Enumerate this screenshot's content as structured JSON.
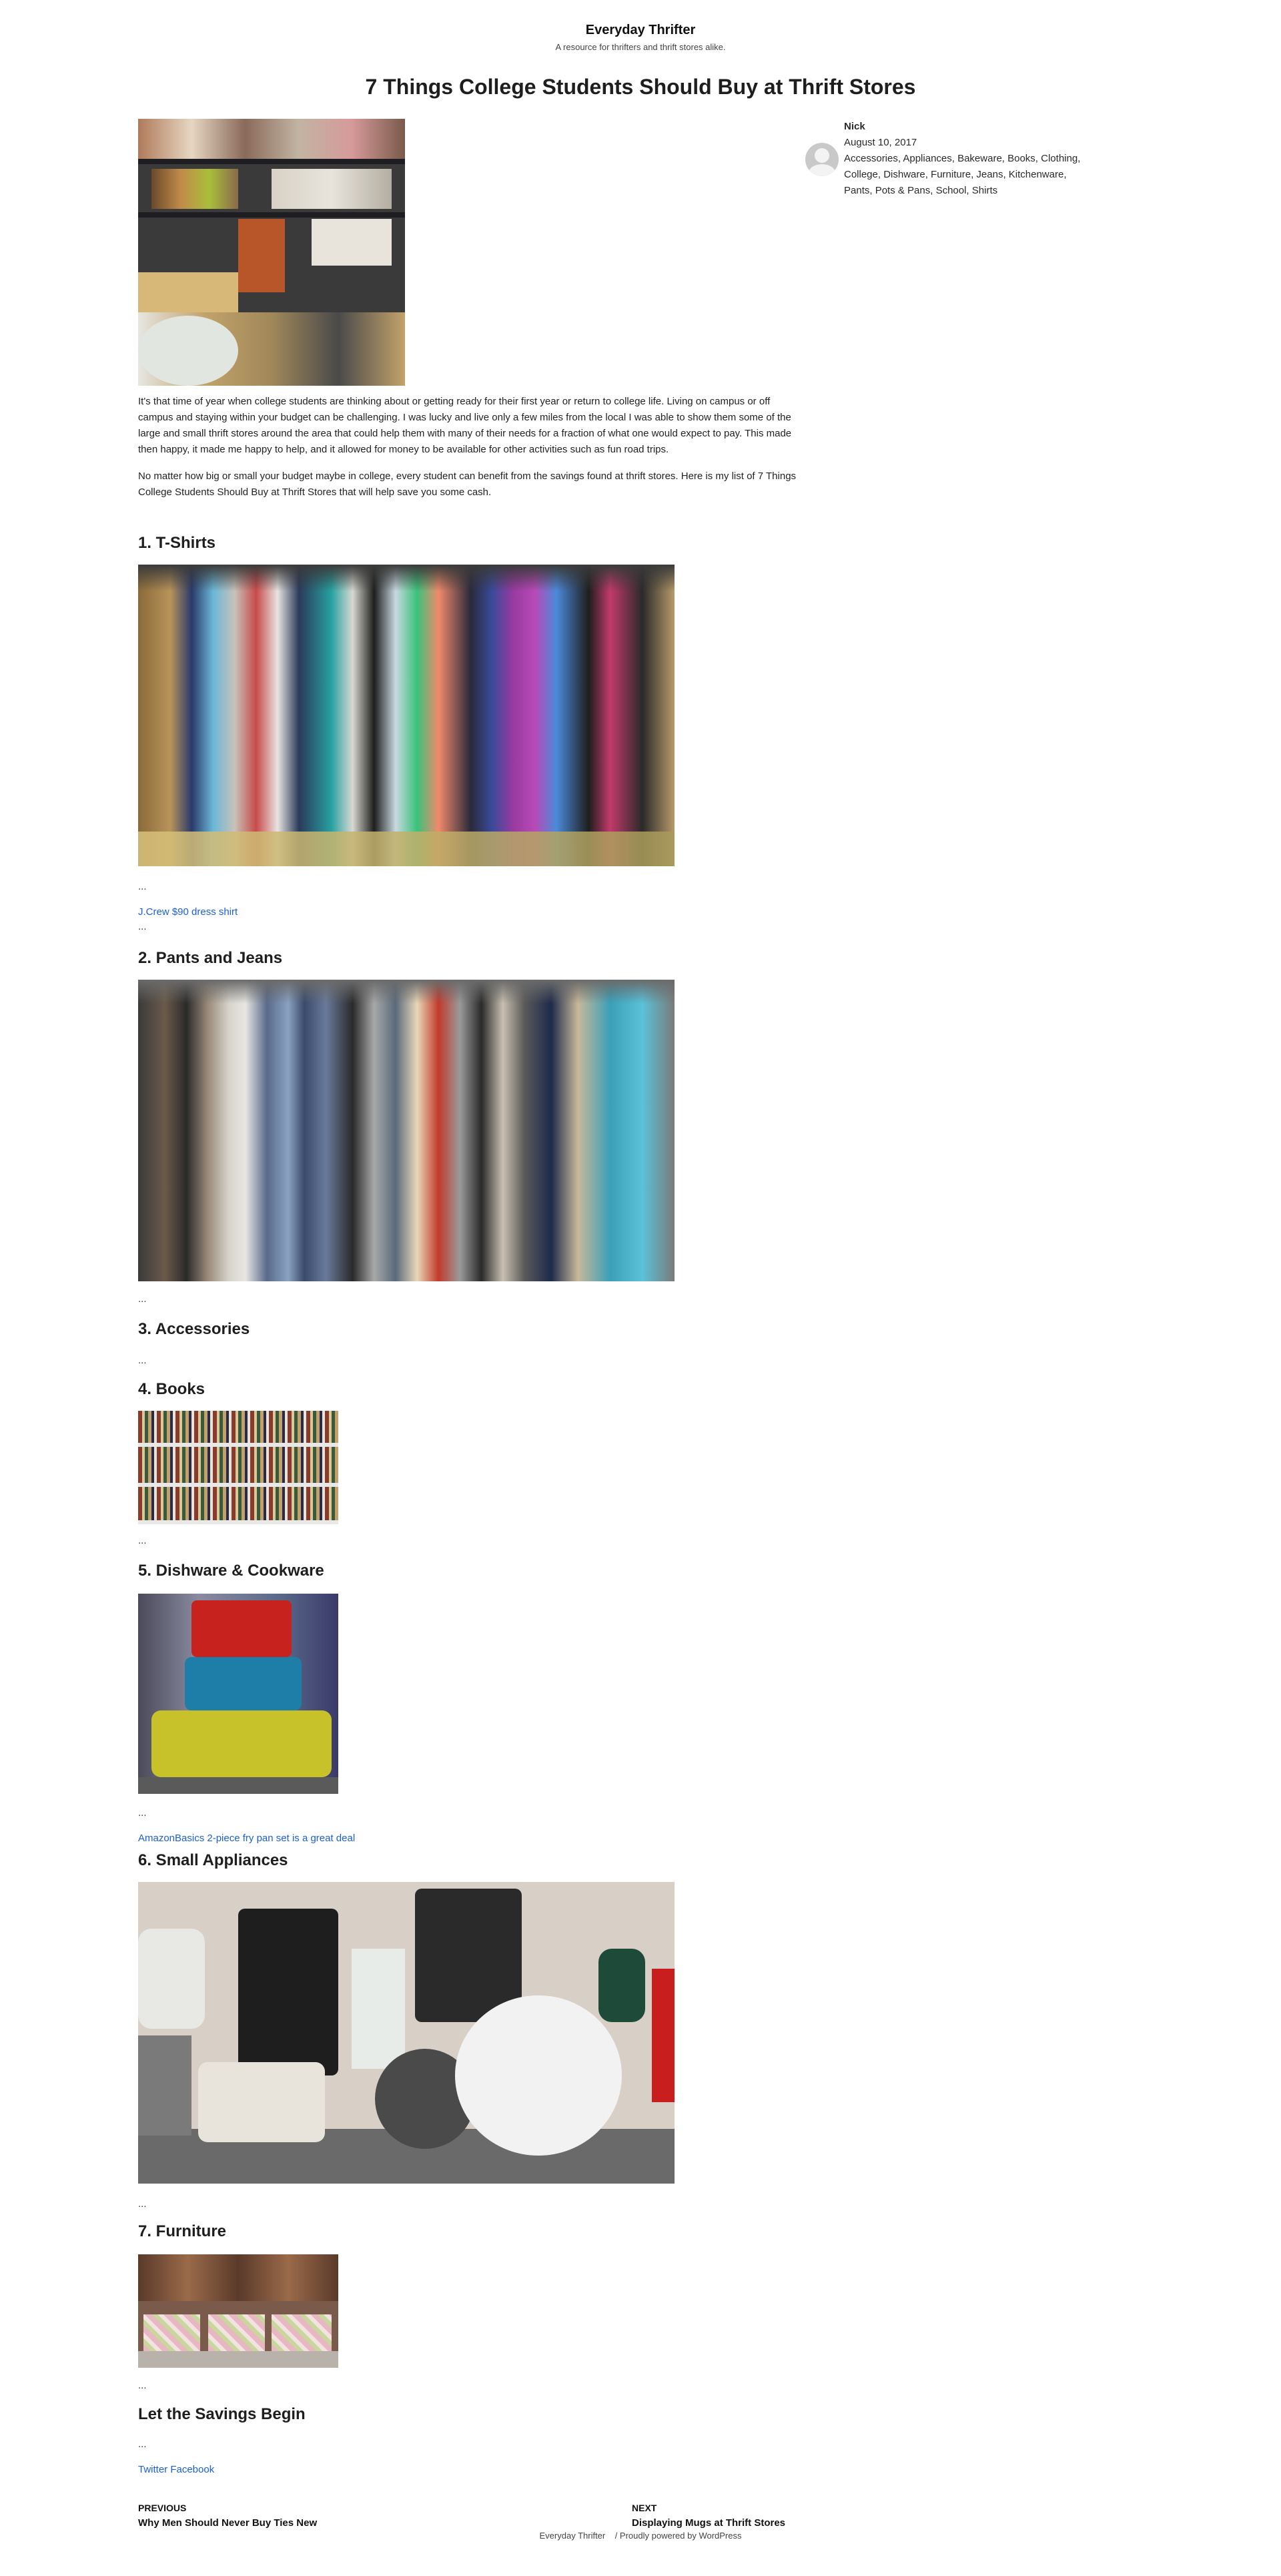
{
  "site": {
    "title": "Everyday Thrifter",
    "tagline": "A resource for thrifters and thrift stores alike."
  },
  "post": {
    "title": "7 Things College Students Should Buy at Thrift Stores",
    "intro_paragraphs": [
      "It's that time of year when college students are thinking about or getting ready for their first year or return to college life. Living on campus or off campus and staying within your budget can be challenging. I was lucky and live only a few miles from the local I was able to show them some of the large and small thrift stores around the area that could help them with many of their needs for a fraction of what one would expect to pay. This made then happy, it made me happy to help, and it allowed for money to be available for other activities such as fun road trips.",
      "No matter how big or small your budget maybe in college, every student can benefit from the savings found at thrift stores. Here is my list of 7 Things College Students Should Buy at Thrift Stores that will help save you some cash."
    ],
    "sections": [
      {
        "heading": "1. T-Shirts",
        "ellipsis": "...",
        "link": "J.Crew $90 dress shirt",
        "ellipsis2": "..."
      },
      {
        "heading": "2. Pants and Jeans",
        "ellipsis": "..."
      },
      {
        "heading": "3. Accessories",
        "ellipsis": "..."
      },
      {
        "heading": "4. Books",
        "ellipsis": "..."
      },
      {
        "heading": "5. Dishware & Cookware",
        "ellipsis": "...",
        "link": "AmazonBasics 2-piece fry pan set is a great deal"
      },
      {
        "heading": "6. Small Appliances",
        "ellipsis": "..."
      },
      {
        "heading": "7. Furniture",
        "ellipsis": "..."
      },
      {
        "heading": "Let the Savings Begin",
        "ellipsis": "..."
      }
    ],
    "share_links": "Twitter Facebook"
  },
  "sidebar": {
    "author": "Nick",
    "date": "August 10, 2017",
    "categories": "Accessories, Appliances, Bakeware, Books, Clothing, College, Dishware, Furniture, Jeans, Kitchenware, Pants, Pots & Pans, School, Shirts"
  },
  "nav": {
    "previous_label": "PREVIOUS",
    "previous_title": "Why Men Should Never Buy Ties New",
    "next_label": "NEXT",
    "next_title": "Displaying Mugs at Thrift Stores"
  },
  "footer": {
    "site": "Everyday Thrifter",
    "powered": "/ Proudly powered by WordPress"
  },
  "icons": {
    "avatar": "default-user-avatar-icon"
  }
}
